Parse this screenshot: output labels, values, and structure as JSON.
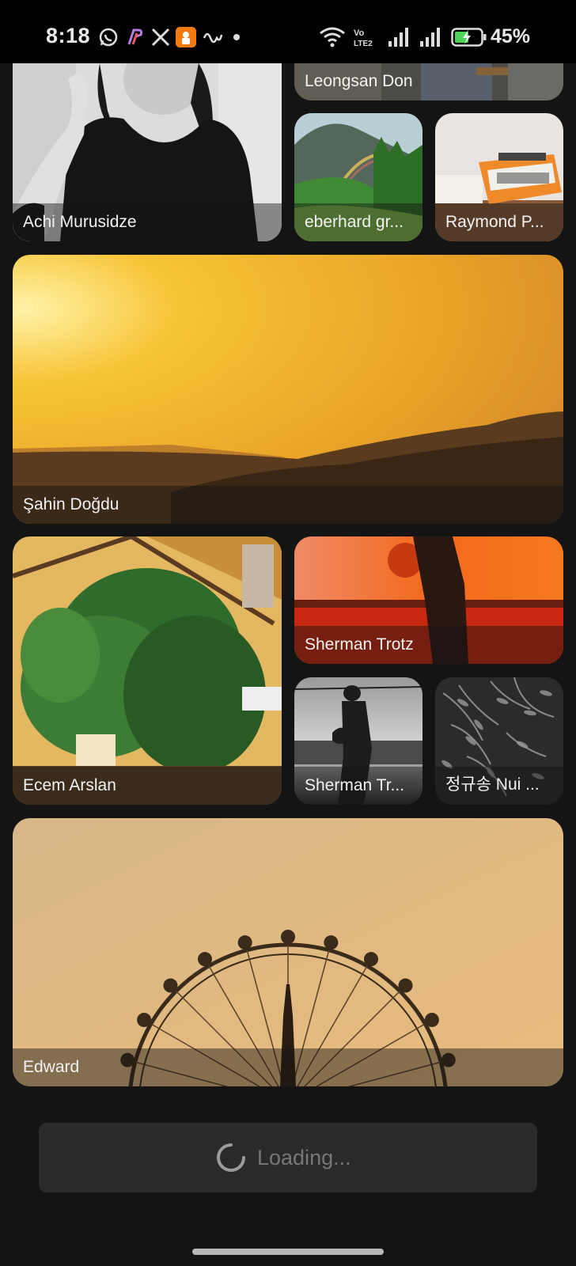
{
  "status_bar": {
    "time": "8:18",
    "battery": "45%",
    "notification_icons": [
      "whatsapp-icon",
      "phonepe-icon",
      "x-icon",
      "app-icon",
      "wave-icon",
      "dot-icon"
    ],
    "system_icons": [
      "wifi-icon",
      "volte-icon",
      "signal-icon",
      "signal-icon",
      "battery-icon"
    ]
  },
  "gallery": {
    "photos": [
      {
        "author": "Achi Murusidze"
      },
      {
        "author": "Leongsan Don"
      },
      {
        "author": "eberhard gr..."
      },
      {
        "author": "Raymond P..."
      },
      {
        "author": "Şahin Doğdu"
      },
      {
        "author": "Ecem Arslan"
      },
      {
        "author": "Sherman Trotz"
      },
      {
        "author": "Sherman Tr..."
      },
      {
        "author": "정규송 Nui ..."
      },
      {
        "author": "Edward"
      }
    ]
  },
  "loading": {
    "label": "Loading..."
  }
}
